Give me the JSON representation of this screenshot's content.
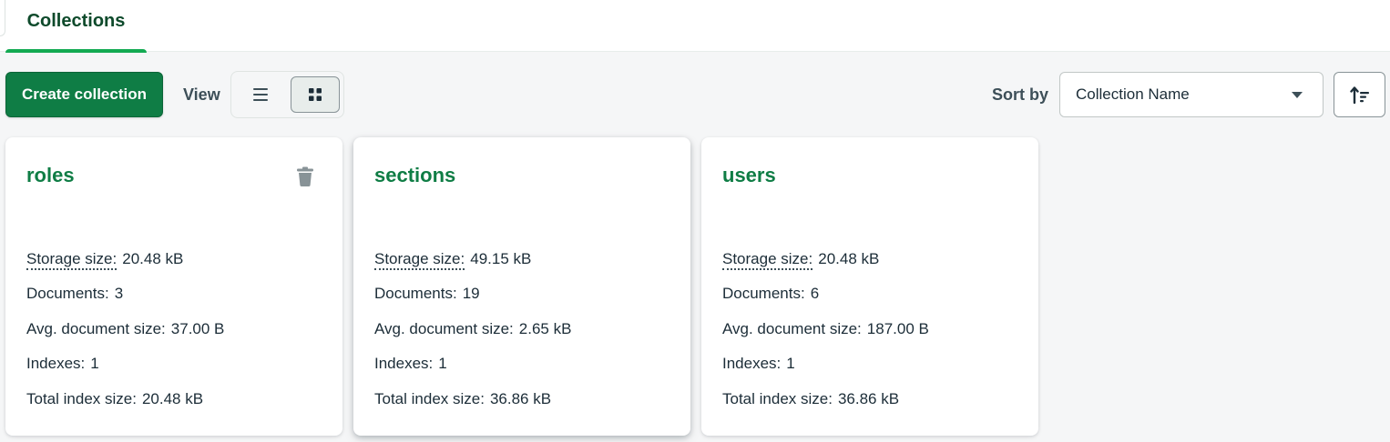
{
  "tabs": [
    {
      "label": "Collections",
      "active": true
    }
  ],
  "toolbar": {
    "create_label": "Create collection",
    "view_label": "View",
    "view_modes": [
      "list-icon",
      "grid-icon"
    ],
    "active_view": "grid",
    "sort_label": "Sort by",
    "sort_value": "Collection Name",
    "sort_direction_icon": "sort-ascending-icon"
  },
  "colors": {
    "brand_green": "#0f7d45",
    "accent_green": "#13aa52"
  },
  "stat_labels": {
    "storage": "Storage size:",
    "documents": "Documents:",
    "avg": "Avg. document size:",
    "indexes": "Indexes:",
    "total_index": "Total index size:"
  },
  "collections": [
    {
      "name": "roles",
      "storage": "20.48 kB",
      "documents": "3",
      "avg": "37.00 B",
      "indexes": "1",
      "total_index": "20.48 kB"
    },
    {
      "name": "sections",
      "storage": "49.15 kB",
      "documents": "19",
      "avg": "2.65 kB",
      "indexes": "1",
      "total_index": "36.86 kB"
    },
    {
      "name": "users",
      "storage": "20.48 kB",
      "documents": "6",
      "avg": "187.00 B",
      "indexes": "1",
      "total_index": "36.86 kB"
    }
  ]
}
